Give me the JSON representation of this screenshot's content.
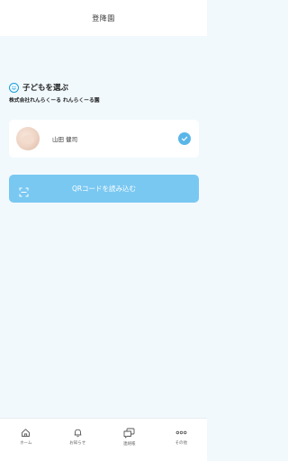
{
  "header": {
    "title": "登降園"
  },
  "section": {
    "icon": "smile-icon",
    "title": "子どもを選ぶ",
    "org_name": "株式会社れんらくーる れんらくーる園"
  },
  "children": [
    {
      "name": "山田 健司",
      "selected": true,
      "icon": "check-circle-icon"
    }
  ],
  "qr_button": {
    "label": "QRコードを読み込む",
    "icon": "qr-scan-icon"
  },
  "tabbar": {
    "items": [
      {
        "label": "ホーム",
        "icon": "home-icon"
      },
      {
        "label": "お知らせ",
        "icon": "bell-icon"
      },
      {
        "label": "連絡帳",
        "icon": "chat-icon"
      },
      {
        "label": "その他",
        "icon": "more-icon"
      }
    ]
  },
  "colors": {
    "background": "#f1f9fd",
    "accent": "#1aa0d8",
    "button": "#79c8f2",
    "check": "#5ab6e8"
  }
}
